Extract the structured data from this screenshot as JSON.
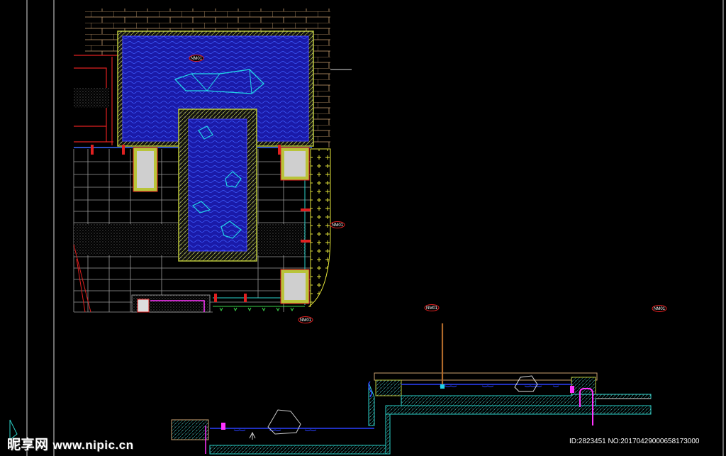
{
  "drawing": {
    "tags": [
      {
        "id": "tag-pool-top",
        "label": "NM01"
      },
      {
        "id": "tag-planting-edge",
        "label": "NM01"
      },
      {
        "id": "tag-plan-bottom",
        "label": "NM01"
      },
      {
        "id": "tag-section-left",
        "label": "NM01"
      },
      {
        "id": "tag-section-right",
        "label": "NM01"
      }
    ]
  },
  "watermark": {
    "site": "昵享网",
    "url": "www.nipic.cn",
    "id_line": "ID:2823451 NO:20170429000658173000"
  },
  "colors": {
    "background": "#000000",
    "water_fill": "#1a1aa8",
    "wave": "#3d5cff",
    "stone": "#22d3e6",
    "coping": "#b8c43a",
    "grid": "#9a9a9a",
    "red": "#e02020",
    "magenta": "#ff33ff",
    "tan": "#caa070"
  }
}
